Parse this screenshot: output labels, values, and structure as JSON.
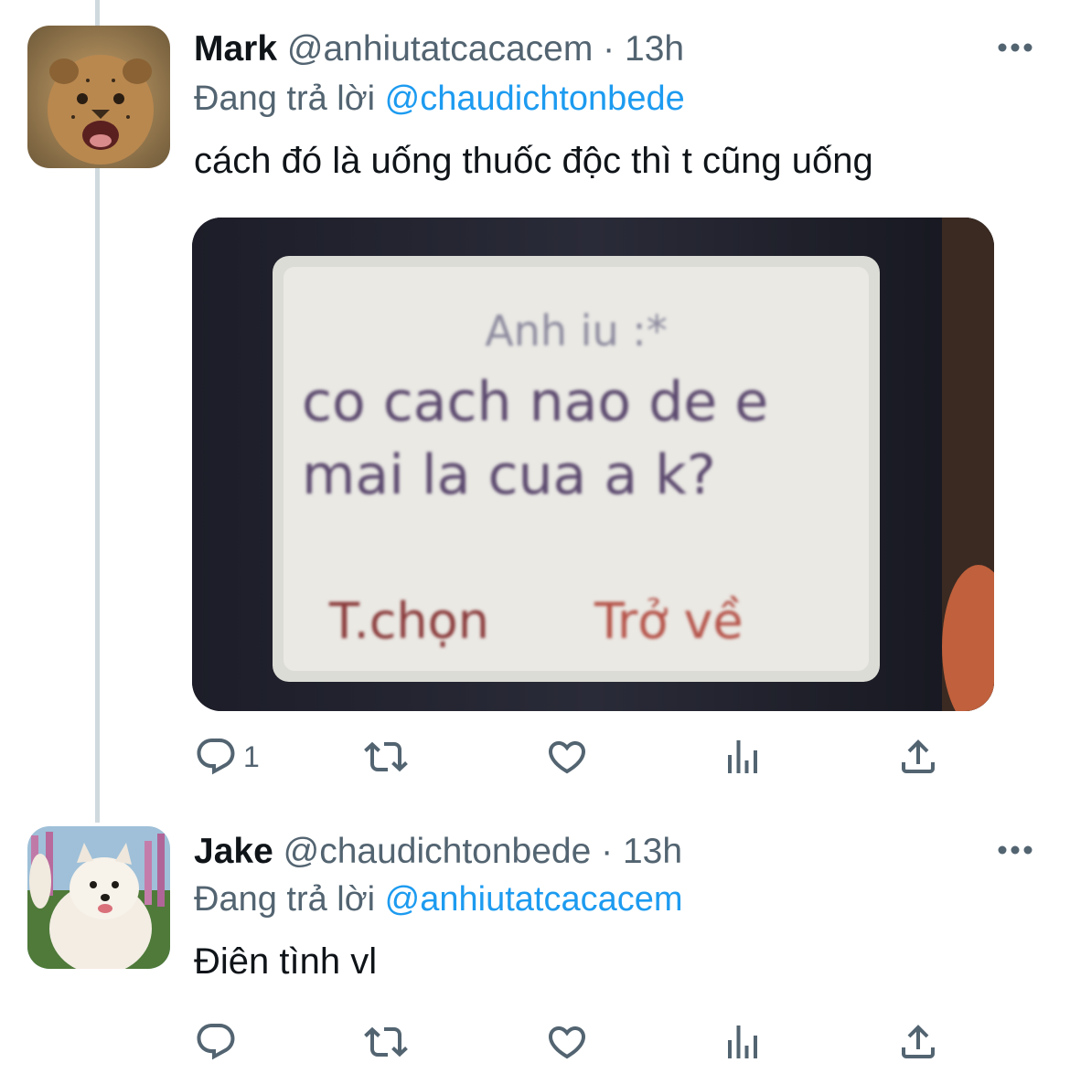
{
  "tweets": [
    {
      "name": "Mark",
      "handle": "@anhiutatcacacem",
      "dot": "·",
      "time": "13h",
      "replying_prefix": "Đang trả lời",
      "replying_to": "@chaudichtonbede",
      "text": "cách đó là uống thuốc độc thì t cũng uống",
      "media": {
        "screen_line1": "Anh iu :*",
        "screen_line2": "co cach nao de e",
        "screen_line3": "mai la cua a k?",
        "softkey_left": "T.chọn",
        "softkey_right": "Trở về"
      },
      "actions": {
        "reply_count": "1",
        "retweet_count": "",
        "like_count": ""
      }
    },
    {
      "name": "Jake",
      "handle": "@chaudichtonbede",
      "dot": "·",
      "time": "13h",
      "replying_prefix": "Đang trả lời",
      "replying_to": "@anhiutatcacacem",
      "text": "Điên tình vl",
      "actions": {
        "reply_count": "",
        "retweet_count": "",
        "like_count": ""
      }
    }
  ],
  "icons": [
    "more-icon",
    "reply-icon",
    "retweet-icon",
    "like-icon",
    "analytics-icon",
    "share-icon"
  ],
  "colors": {
    "link": "#1d9bf0",
    "secondary": "#536471",
    "text": "#0f1419",
    "thread_line": "#cfd9de"
  }
}
